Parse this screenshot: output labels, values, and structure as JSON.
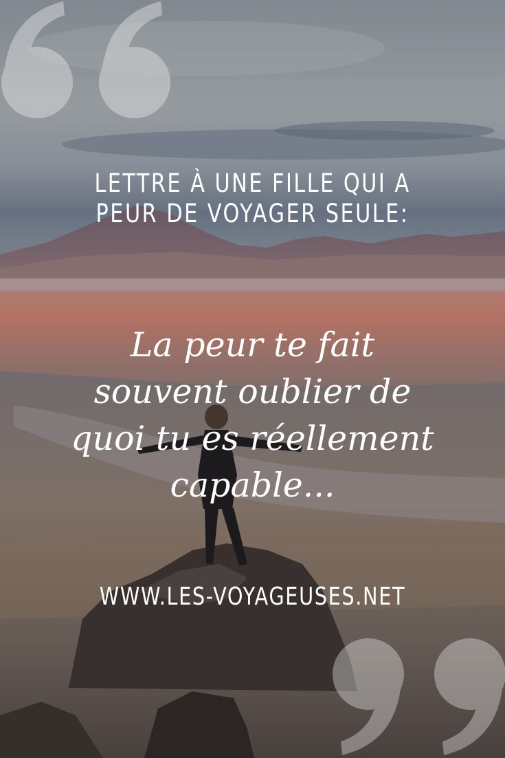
{
  "headline": {
    "lines": [
      "Lettre à une fille qui a",
      "peur de voyager seule:"
    ]
  },
  "quote": {
    "lines": [
      "La peur te fait",
      "souvent oublier de",
      "quoi tu es réellement",
      "capable..."
    ]
  },
  "website": "WWW.LES-VOYAGEUSES.NET",
  "icons": {
    "open_quote": "opening-quotation-mark-icon",
    "close_quote": "closing-quotation-mark-icon"
  },
  "colors": {
    "text": "#ffffff",
    "sky": "#8c949c",
    "mountain": "#7e6a76",
    "lagoon": "#c07a6c",
    "rock": "#3d3634"
  }
}
